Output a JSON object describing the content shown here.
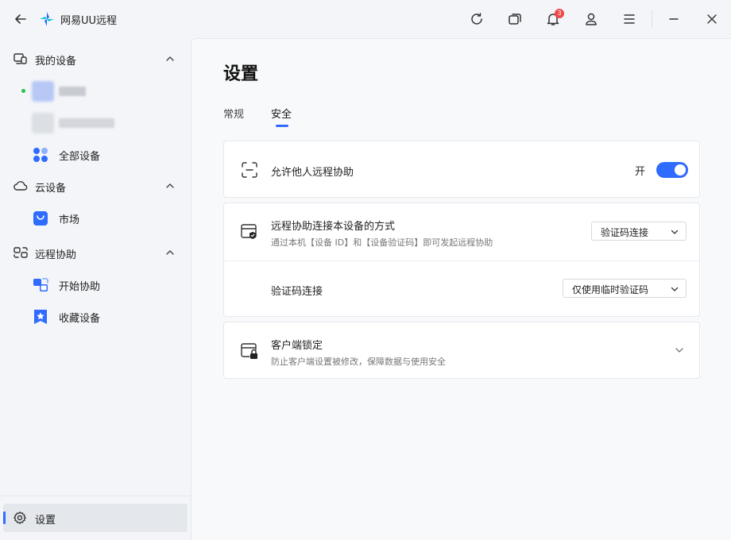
{
  "app": {
    "title": "网易UU远程"
  },
  "titlebar": {
    "notification_count": "3"
  },
  "sidebar": {
    "sections": [
      {
        "label": "我的设备"
      },
      {
        "label": "云设备"
      },
      {
        "label": "远程协助"
      }
    ],
    "items": {
      "all_devices": "全部设备",
      "market": "市场",
      "start_assist": "开始协助",
      "favorite_devices": "收藏设备"
    },
    "settings": "设置"
  },
  "main": {
    "title": "设置",
    "tabs": [
      {
        "label": "常规"
      },
      {
        "label": "安全"
      }
    ],
    "cards": {
      "allow_remote": {
        "title": "允许他人远程协助",
        "toggle_label": "开",
        "enabled": true
      },
      "connection_method": {
        "title": "远程协助连接本设备的方式",
        "subtitle": "通过本机【设备 ID】和【设备验证码】即可发起远程协助",
        "select_value": "验证码连接"
      },
      "code_connection": {
        "title": "验证码连接",
        "select_value": "仅使用临时验证码"
      },
      "client_lock": {
        "title": "客户端锁定",
        "subtitle": "防止客户端设置被修改，保障数据与使用安全"
      }
    }
  },
  "colors": {
    "accent": "#2f6bff",
    "online": "#27c24c",
    "badge": "#f04a4a"
  }
}
